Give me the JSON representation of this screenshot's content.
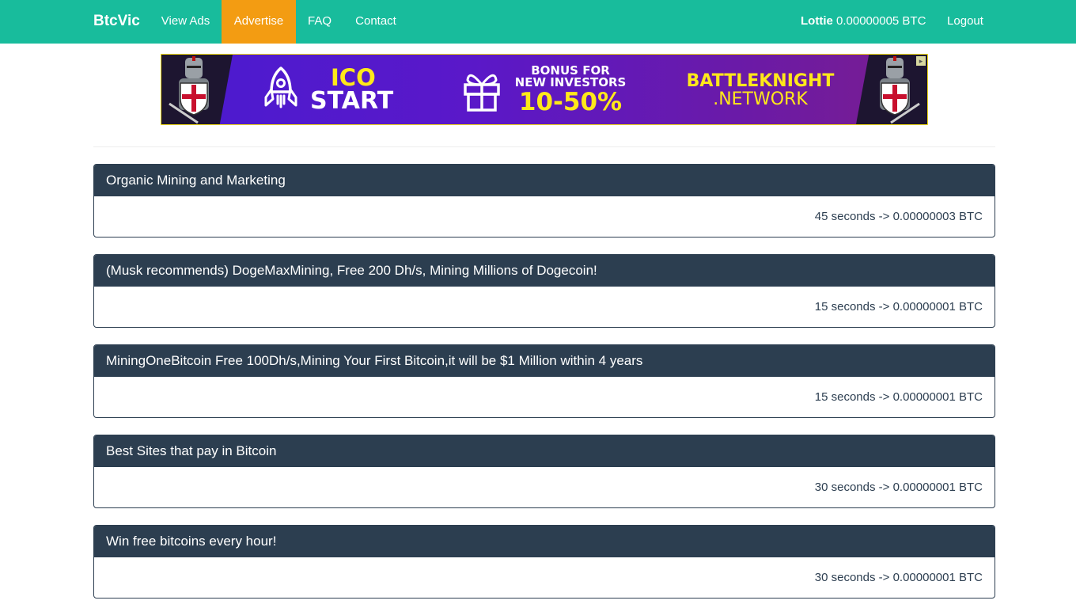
{
  "navbar": {
    "brand": "BtcVic",
    "links": [
      {
        "label": "View Ads"
      },
      {
        "label": "Advertise",
        "active": true
      },
      {
        "label": "FAQ"
      },
      {
        "label": "Contact"
      }
    ],
    "user_name": "Lottie",
    "balance": "0.00000005 BTC",
    "logout": "Logout",
    "colors": {
      "bar": "#18bc9c",
      "active": "#f39c12"
    }
  },
  "banner": {
    "ico_line1": "ICO",
    "ico_line2": "START",
    "bonus_line1": "BONUS FOR",
    "bonus_line2": "NEW INVESTORS",
    "bonus_pct": "10-50%",
    "brand_line1": "BATTLEKNIGHT",
    "brand_line2": ".NETWORK",
    "icons": [
      "knight-icon",
      "rocket-icon",
      "gift-icon",
      "knight-icon"
    ]
  },
  "ads": [
    {
      "title": "Organic Mining and Marketing",
      "reward": "45 seconds -> 0.00000003 BTC"
    },
    {
      "title": "(Musk recommends) DogeMaxMining, Free 200 Dh/s, Mining Millions of Dogecoin!",
      "reward": "15 seconds -> 0.00000001 BTC"
    },
    {
      "title": "MiningOneBitcoin Free 100Dh/s,Mining Your First Bitcoin,it will be $1 Million within 4 years",
      "reward": "15 seconds -> 0.00000001 BTC"
    },
    {
      "title": "Best Sites that pay in Bitcoin",
      "reward": "30 seconds -> 0.00000001 BTC"
    },
    {
      "title": "Win free bitcoins every hour!",
      "reward": "30 seconds -> 0.00000001 BTC"
    }
  ],
  "panel_colors": {
    "header": "#2c3e50"
  }
}
